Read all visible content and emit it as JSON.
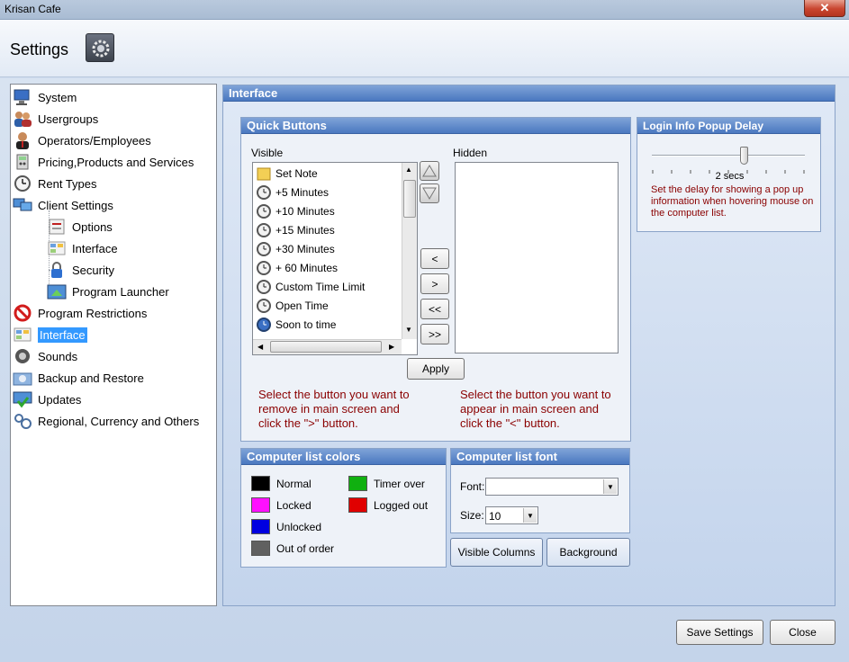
{
  "window": {
    "title": "Krisan Cafe",
    "close_glyph": "✕"
  },
  "header": {
    "title": "Settings",
    "icon": "gear-icon"
  },
  "tree": {
    "items": [
      {
        "label": "System",
        "icon": "monitor-icon"
      },
      {
        "label": "Usergroups",
        "icon": "users-icon"
      },
      {
        "label": "Operators/Employees",
        "icon": "operator-icon"
      },
      {
        "label": "Pricing,Products and Services",
        "icon": "pricing-icon"
      },
      {
        "label": "Rent Types",
        "icon": "clock-icon"
      },
      {
        "label": "Client Settings",
        "icon": "client-computers-icon"
      },
      {
        "label": "Options",
        "icon": "options-icon"
      },
      {
        "label": "Interface",
        "icon": "interface-icon"
      },
      {
        "label": "Security",
        "icon": "lock-icon"
      },
      {
        "label": "Program Launcher",
        "icon": "launcher-icon"
      },
      {
        "label": "Program Restrictions",
        "icon": "no-entry-icon"
      },
      {
        "label": "Interface",
        "icon": "interface-icon"
      },
      {
        "label": "Sounds",
        "icon": "speaker-icon"
      },
      {
        "label": "Backup and Restore",
        "icon": "backup-icon"
      },
      {
        "label": "Updates",
        "icon": "updates-icon"
      },
      {
        "label": "Regional, Currency and Others",
        "icon": "regional-icon"
      }
    ],
    "selected": "Interface"
  },
  "panel": {
    "title": "Interface"
  },
  "quick_buttons": {
    "title": "Quick Buttons",
    "visible_label": "Visible",
    "hidden_label": "Hidden",
    "visible_items": [
      "Set Note",
      "+5 Minutes",
      "+10 Minutes",
      "+15 Minutes",
      "+30 Minutes",
      "+ 60 Minutes",
      "Custom Time Limit",
      "Open Time",
      "Soon to time"
    ],
    "move_left": "<",
    "move_right": ">",
    "move_all_left": "<<",
    "move_all_right": ">>",
    "apply": "Apply",
    "note_left": [
      "Select the button you want to",
      "remove  in main screen and",
      "click the \">\" button."
    ],
    "note_right": [
      "Select the button you want to",
      "appear in main screen and",
      "click the \"<\" button."
    ]
  },
  "login_popup": {
    "title": "Login Info Popup Delay",
    "slider_value_label": "2 secs",
    "slider_fraction": 0.6,
    "description": [
      "Set the delay for showing a pop up",
      "information when hovering mouse on",
      "the computer list."
    ]
  },
  "list_colors": {
    "title": "Computer list colors",
    "items": [
      {
        "label": "Normal",
        "color": "#000000"
      },
      {
        "label": "Timer over",
        "color": "#10b010"
      },
      {
        "label": "Locked",
        "color": "#ff10ff"
      },
      {
        "label": "Logged out",
        "color": "#e00000"
      },
      {
        "label": "Unlocked",
        "color": "#0000e0"
      },
      {
        "label": "Out of order",
        "color": "#606060"
      }
    ]
  },
  "list_font": {
    "title": "Computer list font",
    "font_label": "Font:",
    "font_value": "",
    "size_label": "Size:",
    "size_value": "10"
  },
  "buttons": {
    "visible_columns": "Visible Columns",
    "background": "Background",
    "save_settings": "Save Settings",
    "close": "Close"
  }
}
